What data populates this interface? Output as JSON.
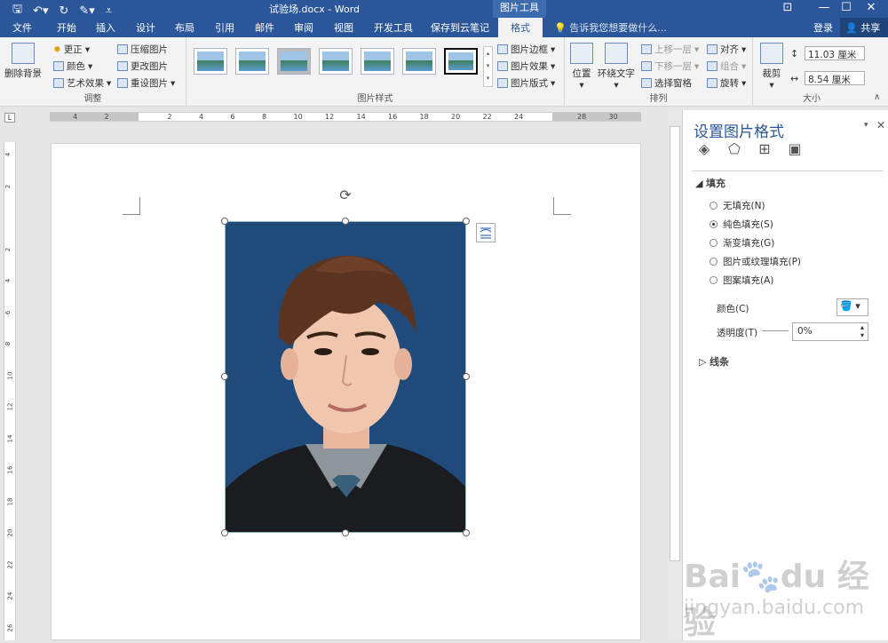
{
  "titlebar": {
    "doc_title": "试验场.docx - Word",
    "tools_tab": "图片工具",
    "min": "—",
    "max": "☐",
    "close": "✕"
  },
  "tabs": [
    "文件",
    "开始",
    "插入",
    "设计",
    "布局",
    "引用",
    "邮件",
    "审阅",
    "视图",
    "开发工具",
    "保存到云笔记",
    "格式"
  ],
  "active_tab": "格式",
  "tellme": "告诉我您想要做什么...",
  "login": "登录",
  "share": "共享",
  "ribbon": {
    "adjust": {
      "remove_bg": "删除背景",
      "corrections": "更正",
      "color": "颜色",
      "artistic": "艺术效果",
      "compress": "压缩图片",
      "change": "更改图片",
      "reset": "重设图片",
      "label": "调整"
    },
    "styles": {
      "border": "图片边框",
      "effects": "图片效果",
      "layout": "图片版式",
      "label": "图片样式"
    },
    "arrange": {
      "position": "位置",
      "wrap": "环绕文字",
      "forward": "上移一层",
      "backward": "下移一层",
      "selection": "选择窗格",
      "align": "对齐",
      "group": "组合",
      "rotate": "旋转",
      "label": "排列"
    },
    "size": {
      "crop": "裁剪",
      "height": "11.03 厘米",
      "width": "8.54 厘米",
      "label": "大小"
    }
  },
  "ruler": {
    "h_numbers": [
      "4",
      "2",
      "",
      "2",
      "4",
      "6",
      "8",
      "10",
      "12",
      "14",
      "16",
      "18",
      "20",
      "22",
      "24",
      "",
      "28",
      "30"
    ],
    "v_numbers": [
      "4",
      "2",
      "",
      "2",
      "4",
      "6",
      "8",
      "10",
      "12",
      "14",
      "16",
      "18",
      "20",
      "22",
      "24",
      "26"
    ],
    "corner": "L"
  },
  "pane": {
    "title": "设置图片格式",
    "fill_header": "填充",
    "options": [
      "无填充(N)",
      "纯色填充(S)",
      "渐变填充(G)",
      "图片或纹理填充(P)",
      "图案填充(A)"
    ],
    "selected_option": 1,
    "color_label": "颜色(C)",
    "transparency_label": "透明度(T)",
    "transparency_value": "0%",
    "line_header": "线条"
  },
  "watermark": {
    "brand": "Bai",
    "brand2": "du",
    "cn": "经验",
    "url": "jingyan.baidu.com"
  },
  "colors": {
    "word_blue": "#2b579a",
    "photo_bg": "#1f4a7a"
  }
}
